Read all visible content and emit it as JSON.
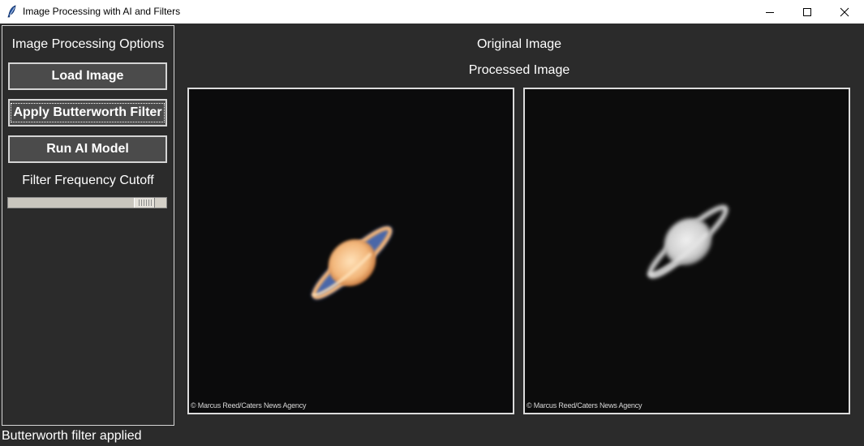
{
  "window": {
    "title": "Image Processing with AI and Filters",
    "icon": "feather-icon",
    "controls": [
      "minimize-icon",
      "maximize-icon",
      "close-icon"
    ]
  },
  "sidebar": {
    "heading": "Image Processing Options",
    "buttons": {
      "load": "Load Image",
      "filter": "Apply Butterworth Filter",
      "ai": "Run AI Model"
    },
    "slider": {
      "label": "Filter Frequency Cutoff",
      "value_fraction": 0.92
    }
  },
  "main": {
    "original_label": "Original Image",
    "processed_label": "Processed Image",
    "original_credit": "© Marcus Reed/Caters News Agency",
    "processed_credit": "© Marcus Reed/Caters News Agency"
  },
  "status": "Butterworth filter applied",
  "colors": {
    "background": "#2b2b2b",
    "button": "#4b4b4b",
    "panel_border": "#dcdcdc",
    "saturn_original": "#f2c08a",
    "saturn_processed": "#d9d9d9"
  }
}
